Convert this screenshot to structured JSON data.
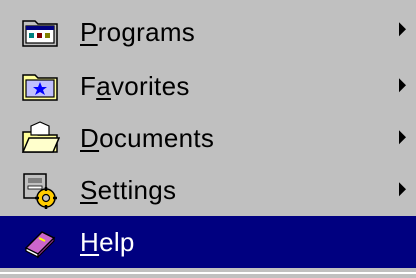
{
  "menu": {
    "items": [
      {
        "label_accel": "P",
        "label_rest": "rograms",
        "label_pre": "",
        "icon": "programs-folder-icon",
        "has_submenu": true,
        "selected": false
      },
      {
        "label_pre": "F",
        "label_accel": "a",
        "label_rest": "vorites",
        "icon": "favorites-folder-icon",
        "has_submenu": true,
        "selected": false
      },
      {
        "label_pre": "",
        "label_accel": "D",
        "label_rest": "ocuments",
        "icon": "documents-folder-icon",
        "has_submenu": true,
        "selected": false
      },
      {
        "label_pre": "",
        "label_accel": "S",
        "label_rest": "ettings",
        "icon": "settings-icon",
        "has_submenu": true,
        "selected": false
      },
      {
        "label_pre": "",
        "label_accel": "H",
        "label_rest": "elp",
        "icon": "help-book-icon",
        "has_submenu": false,
        "selected": true
      }
    ]
  },
  "colors": {
    "menu_bg": "#c0c0c0",
    "highlight_bg": "#000080",
    "highlight_text": "#ffffff",
    "text": "#000000"
  }
}
